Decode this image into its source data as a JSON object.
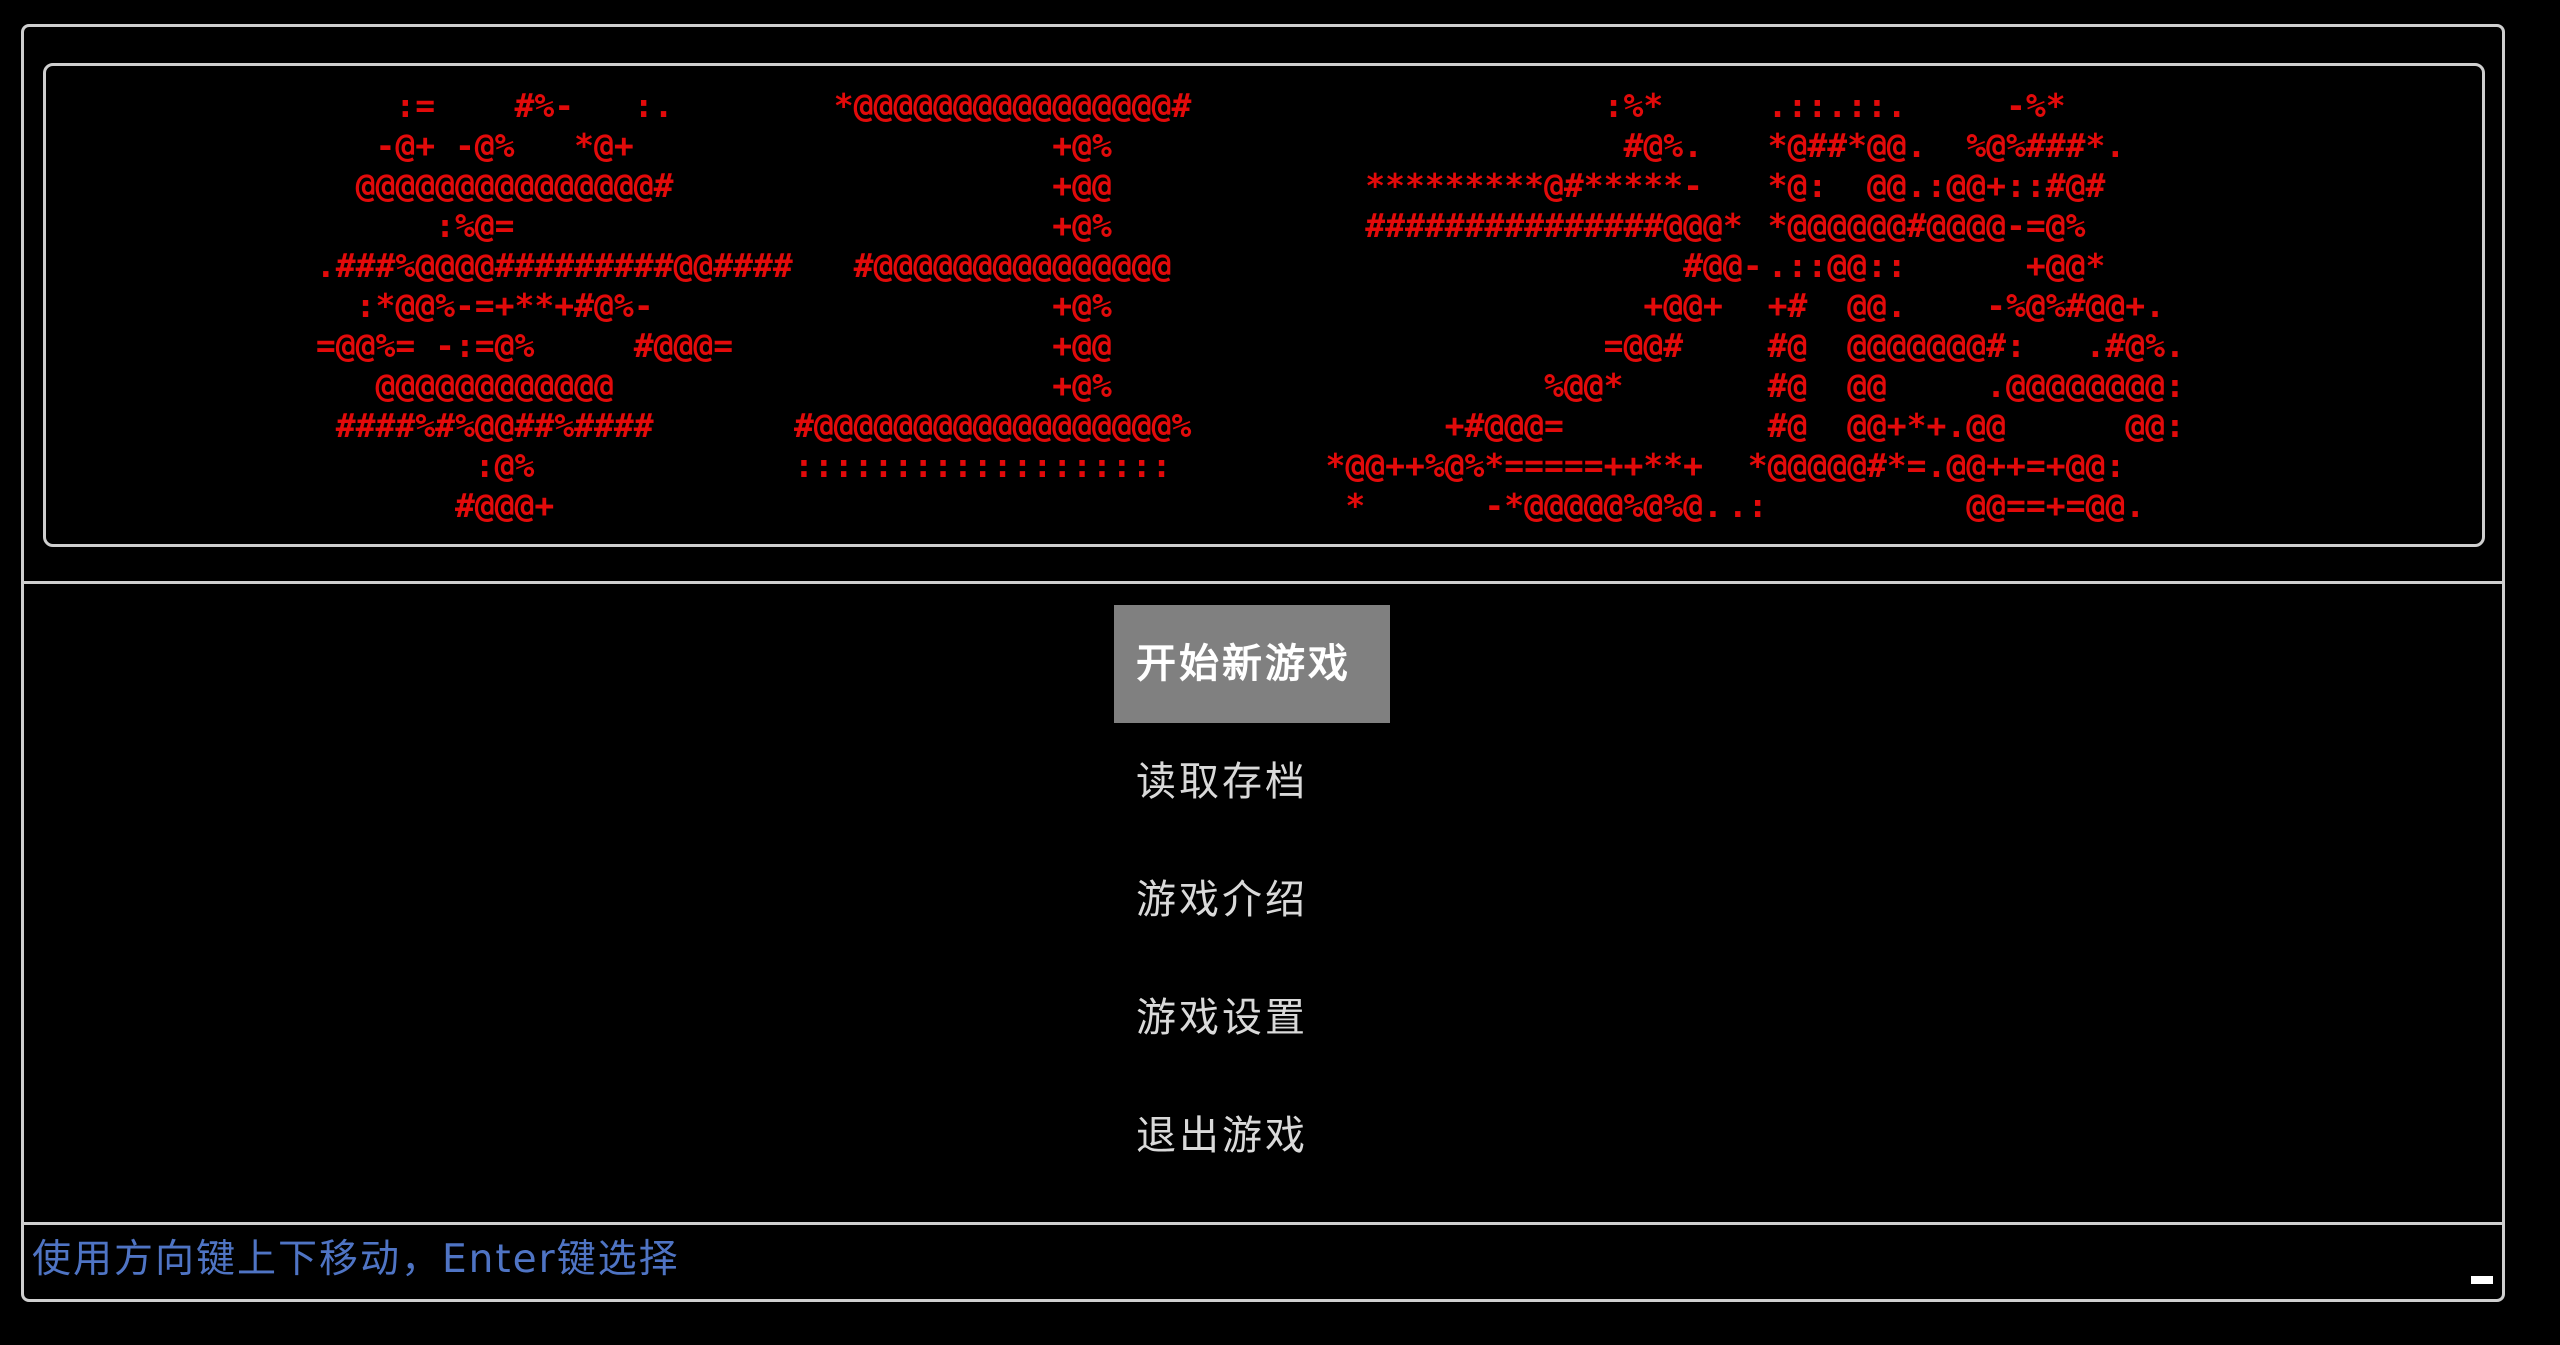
{
  "banner": {
    "art_blocks": [
      [
        "     :=    #%-   :.",
        "    -@+ -@%   *@+",
        "   @@@@@@@@@@@@@@@#",
        "       :%@=",
        " .###%@@@@#########@@####",
        "   :*@@%-=+**+#@%-",
        " =@@%= -:=@%     #@@@=",
        "    @@@@@@@@@@@@",
        "  ####%#%@@##%####",
        "         :@%",
        "        #@@@+"
      ],
      [
        "  *@@@@@@@@@@@@@@@@#",
        "             +@%",
        "             +@@",
        "             +@%",
        "   #@@@@@@@@@@@@@@@",
        "             +@%",
        "             +@@",
        "             +@%",
        "#@@@@@@@@@@@@@@@@@@%",
        ":::::::::::::::::::"
      ],
      [
        "                  :%*",
        "                   #@%.",
        "      *********@#*****-",
        "      ###############@@@*",
        "                      #@@-",
        "                    +@@+",
        "                  =@@#",
        "               %@@*",
        "          +#@@@=",
        "    *@@++%@%*=====++**+",
        "     *      -*@@@@@%@%@."
      ],
      [
        "   .::.::.     -%*",
        "   *@##*@@.  %@%###*.",
        "   *@:  @@.:@@+::#@#",
        "   *@@@@@@#@@@@-=@%",
        "   .::@@::      +@@*",
        "   +#  @@.    -%@%#@@+.",
        "   #@  @@@@@@@#:   .#@%.",
        "   #@  @@     .@@@@@@@@:",
        "   #@  @@+*+.@@      @@:",
        "  *@@@@@#*=.@@++=+@@:",
        " .:          @@==+=@@."
      ]
    ]
  },
  "menu": {
    "items": [
      {
        "label": "开始新游戏",
        "selected": true
      },
      {
        "label": "读取存档",
        "selected": false
      },
      {
        "label": "游戏介绍",
        "selected": false
      },
      {
        "label": "游戏设置",
        "selected": false
      },
      {
        "label": "退出游戏",
        "selected": false
      }
    ]
  },
  "status_bar": {
    "hint": "使用方向键上下移动，Enter键选择"
  },
  "colors": {
    "art": "#e20a0a",
    "border": "#cfcfcf",
    "selected_bg": "#808080",
    "hint": "#4f74c4"
  }
}
